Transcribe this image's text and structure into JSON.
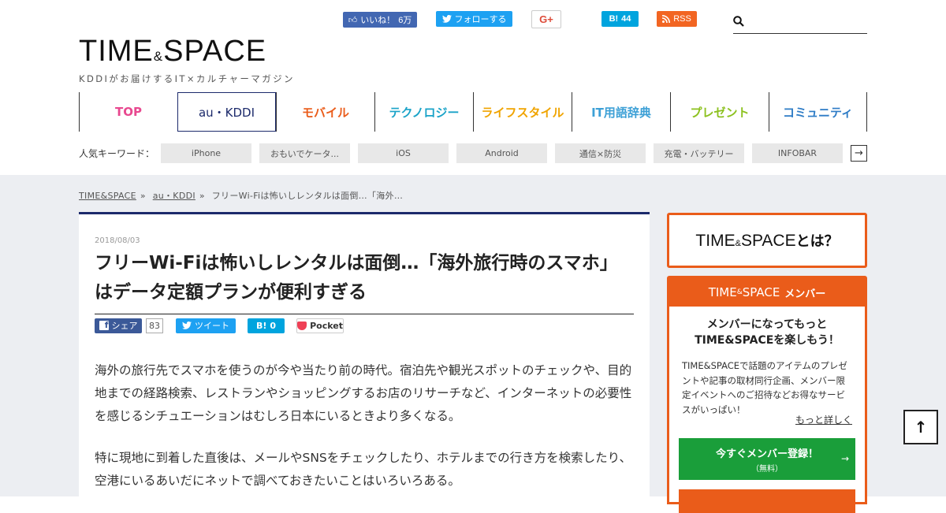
{
  "social": {
    "like_label": "いいね！",
    "like_count": "6万",
    "follow_label": "フォローする",
    "gplus_label": "G+",
    "hatena_label": "B!",
    "hatena_count": "44",
    "rss_label": "RSS"
  },
  "search": {
    "placeholder": ""
  },
  "logo": {
    "time": "TIME",
    "amp": "&",
    "space": "SPACE",
    "tagline": "KDDIがお届けするIT×カルチャーマガジン"
  },
  "nav": {
    "items": [
      {
        "label": "TOP",
        "color": "#e8488f"
      },
      {
        "label": "au・KDDI",
        "color": "#1c2a6b"
      },
      {
        "label": "モバイル",
        "color": "#ea5c1a"
      },
      {
        "label": "テクノロジー",
        "color": "#1aa3c8"
      },
      {
        "label": "ライフスタイル",
        "color": "#f0a400"
      },
      {
        "label": "IT用語辞典",
        "color": "#3da0d6"
      },
      {
        "label": "プレゼント",
        "color": "#8cc11f"
      },
      {
        "label": "コミュニティ",
        "color": "#2e7cc6"
      }
    ]
  },
  "keywords": {
    "label": "人気キーワード：",
    "tags": [
      "iPhone",
      "おもいでケータ...",
      "iOS",
      "Android",
      "通信×防災",
      "充電・バッテリー",
      "INFOBAR"
    ],
    "next": "→"
  },
  "breadcrumb": {
    "home": "TIME&SPACE",
    "sep1": "»",
    "category": "au・KDDI",
    "sep2": "»",
    "current": "フリーWi-Fiは怖いしレンタルは面倒…「海外…"
  },
  "article": {
    "date": "2018/08/03",
    "title": "フリーWi-Fiは怖いしレンタルは面倒…「海外旅行時のスマホ」はデータ定額プランが便利すぎる",
    "share": {
      "facebook": "シェア",
      "facebook_count": "83",
      "twitter": "ツイート",
      "hatena": "B!",
      "hatena_count": "0",
      "pocket": "Pocket"
    },
    "paragraph1": "海外の旅行先でスマホを使うのが今や当たり前の時代。宿泊先や観光スポットのチェックや、目的地までの経路検索、レストランやショッピングするお店のリサーチなど、インターネットの必要性を感じるシチュエーションはむしろ日本にいるときより多くなる。",
    "paragraph2": "特に現地に到着した直後は、メールやSNSをチェックしたり、ホテルまでの行き方を検索したり、空港にいるあいだにネットで調べておきたいことはいろいろある。"
  },
  "sidebar": {
    "about": {
      "time": "TIME",
      "amp": "&",
      "space": "SPACE",
      "suffix": "とは？"
    },
    "member": {
      "head_time": "TIME",
      "head_amp": "&",
      "head_space": "SPACE",
      "head_suffix": "メンバー",
      "lead1": "メンバーになってもっと",
      "lead2": "TIME&SPACEを楽しもう！",
      "desc": "TIME&SPACEで話題のアイテムのプレゼントや記事の取材同行企画、メンバー限定イベントへのご招待などお得なサービスがいっぱい！",
      "more": "もっと詳しく",
      "register": "今すぐメンバー登録！",
      "register_sub": "（無料）",
      "arrow": "→"
    }
  },
  "to_top": "↑",
  "colors": {
    "accent_orange": "#ea5c1a",
    "navy": "#1c2a6b",
    "register_green": "#1a9e3a",
    "background_gray": "#eceef2"
  }
}
